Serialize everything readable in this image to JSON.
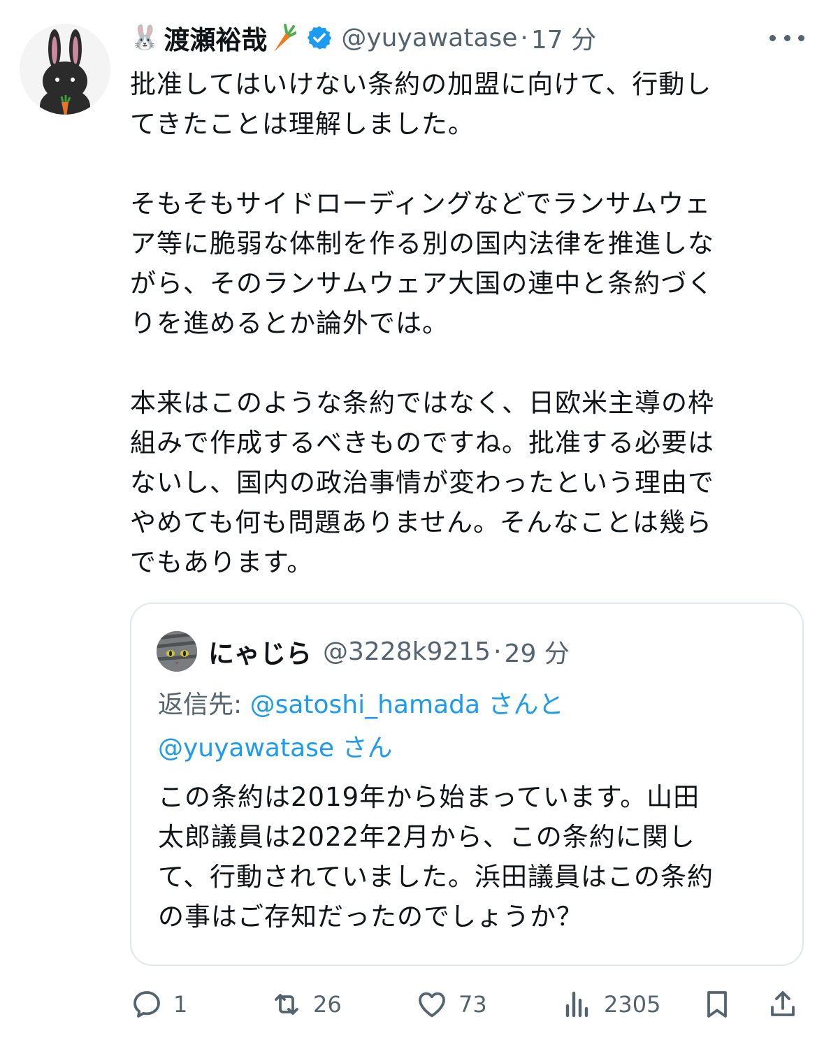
{
  "author": {
    "emoji": "🐰",
    "name": "渡瀬裕哉",
    "handle": "@yuyawatase",
    "separator": "·",
    "time": "17 分",
    "verified": true
  },
  "tweet": {
    "text": "批准してはいけない条約の加盟に向けて、行動し\nてきたことは理解しました。\n\nそもそもサイドローディングなどでランサムウェ\nア等に脆弱な体制を作る別の国内法律を推進しな\nがら、そのランサムウェア大国の連中と条約づく\nりを進めるとか論外では。\n\n本来はこのような条約ではなく、日欧米主導の枠\n組みで作成するべきものですね。批准する必要は\nないし、国内の政治事情が変わったという理由で\nやめても何も問題ありません。そんなことは幾ら\nでもあります。"
  },
  "quoted": {
    "name": "にゃじら",
    "handle": "@3228k9215",
    "separator": "·",
    "time": "29 分",
    "reply_prefix": "返信先: ",
    "mention1": "@satoshi_hamada",
    "mention1_suffix": "さんと",
    "mention2": "@yuyawatase",
    "mention2_suffix": "さん",
    "text": "この条約は2019年から始まっています。山田\n太郎議員は2022年2月から、この条約に関し\nて、行動されていました。浜田議員はこの条約\nの事はご存知だったのでしょうか？"
  },
  "actions": {
    "replies": "1",
    "retweets": "26",
    "likes": "73",
    "views": "2305"
  },
  "colors": {
    "text": "#0f1419",
    "secondary": "#536471",
    "link": "#1d9bf0",
    "border": "#e1e8ed"
  }
}
